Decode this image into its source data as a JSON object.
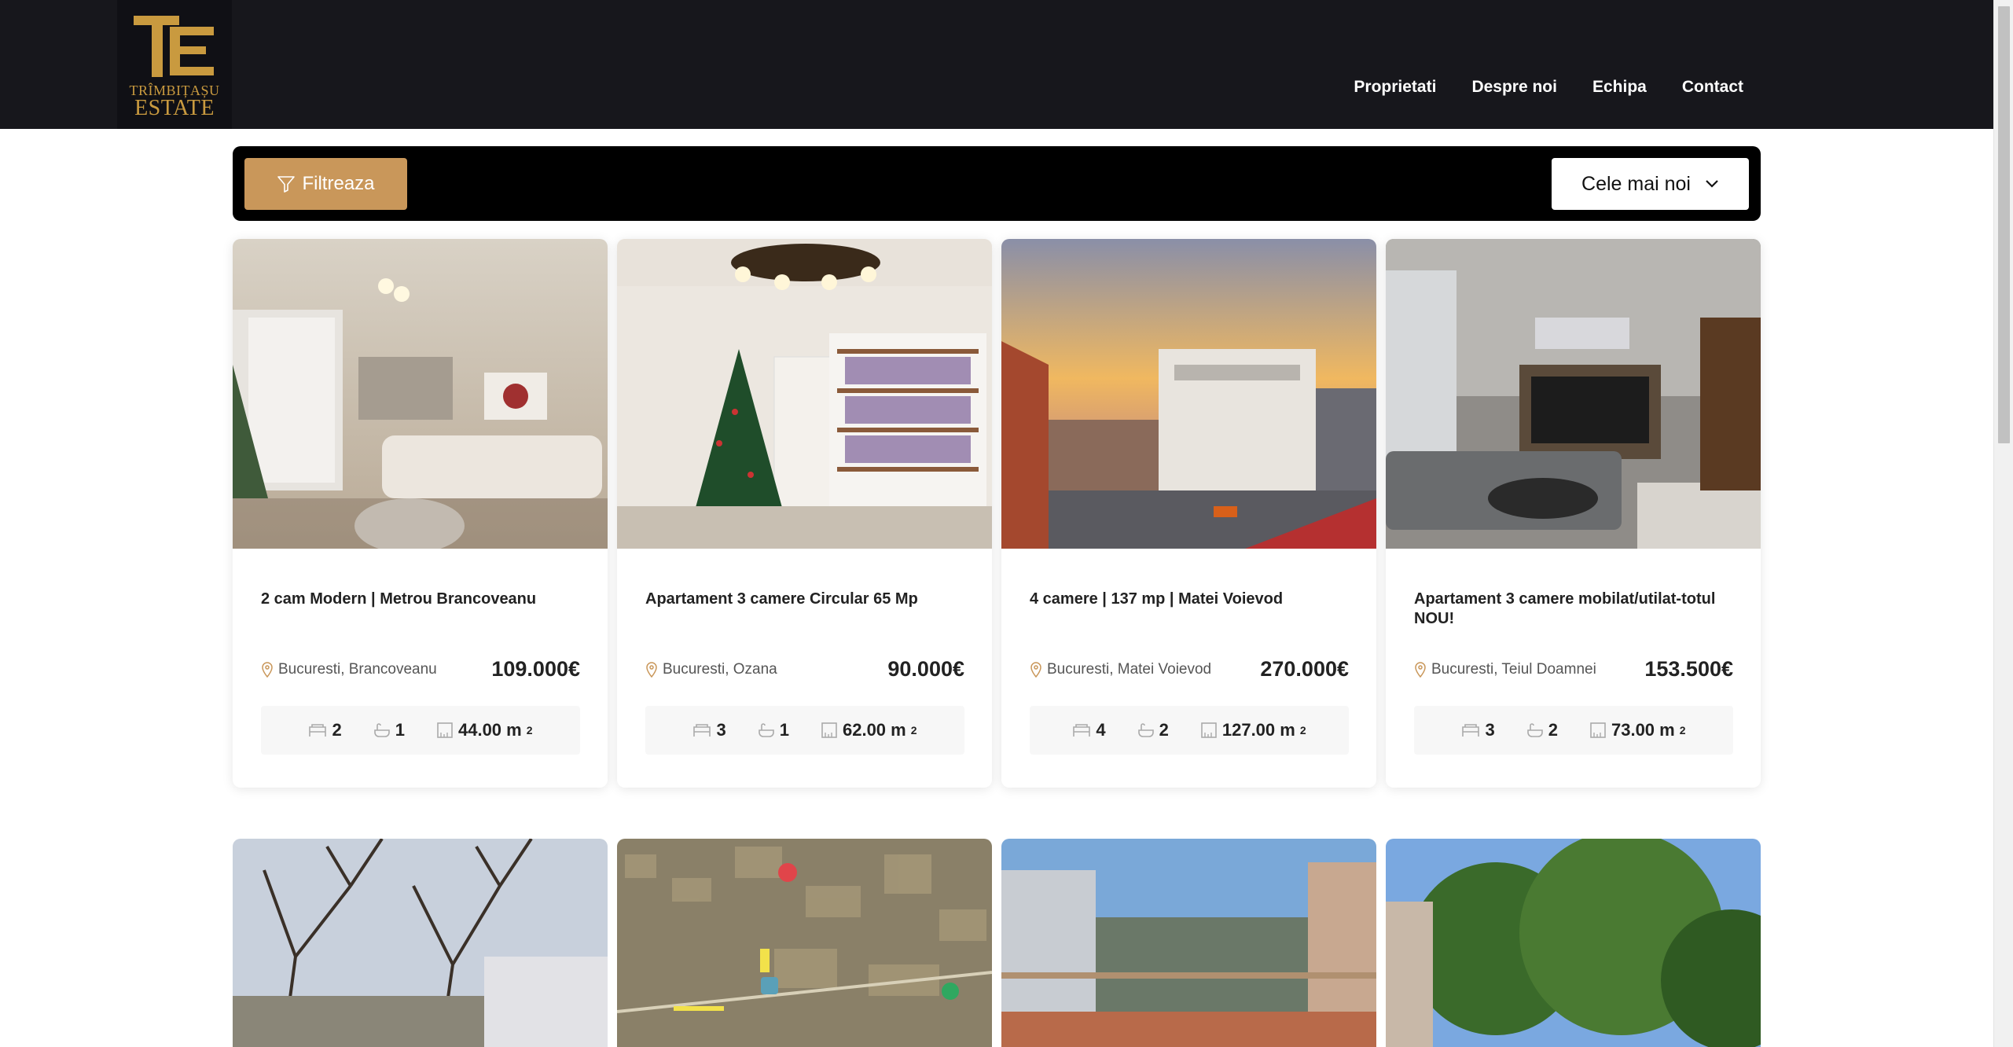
{
  "logo": {
    "line1": "TRÎMBIȚAȘU",
    "line2": "ESTATE"
  },
  "nav": [
    "Proprietati",
    "Despre noi",
    "Echipa",
    "Contact"
  ],
  "filter": {
    "label": "Filtreaza"
  },
  "sort": {
    "label": "Cele mai noi"
  },
  "colors": {
    "accent": "#c9975a",
    "header": "#17171c"
  },
  "listings": [
    {
      "title": "2 cam Modern | Metrou Brancoveanu",
      "location": "Bucuresti, Brancoveanu",
      "price": "109.000€",
      "rooms": "2",
      "baths": "1",
      "area": "44.00 m",
      "area_unit": "2"
    },
    {
      "title": "Apartament 3 camere Circular 65 Mp",
      "location": "Bucuresti, Ozana",
      "price": "90.000€",
      "rooms": "3",
      "baths": "1",
      "area": "62.00 m",
      "area_unit": "2"
    },
    {
      "title": "4 camere | 137 mp | Matei Voievod",
      "location": "Bucuresti, Matei Voievod",
      "price": "270.000€",
      "rooms": "4",
      "baths": "2",
      "area": "127.00 m",
      "area_unit": "2"
    },
    {
      "title": "Apartament 3 camere mobilat/utilat-totul NOU!",
      "location": "Bucuresti, Teiul Doamnei",
      "price": "153.500€",
      "rooms": "3",
      "baths": "2",
      "area": "73.00 m",
      "area_unit": "2"
    }
  ]
}
